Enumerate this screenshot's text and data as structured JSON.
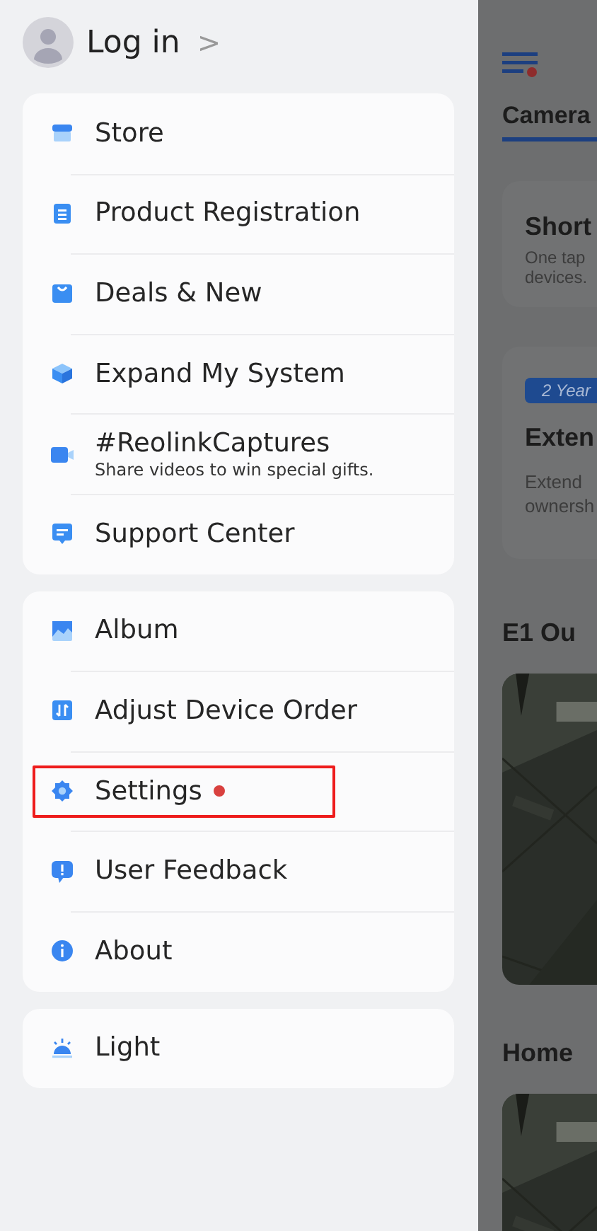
{
  "header": {
    "login_label": "Log in",
    "chevron": ">"
  },
  "menu_groups": [
    {
      "items": [
        {
          "kind": "store",
          "label": "Store",
          "badge": false,
          "highlighted": false
        },
        {
          "kind": "registration",
          "label": "Product Registration",
          "badge": false,
          "highlighted": false
        },
        {
          "kind": "deals",
          "label": "Deals & New",
          "badge": false,
          "highlighted": false
        },
        {
          "kind": "expand",
          "label": "Expand My System",
          "badge": false,
          "highlighted": false
        },
        {
          "kind": "captures",
          "label": "#ReolinkCaptures",
          "subtitle": "Share videos to win special gifts.",
          "badge": false,
          "highlighted": false
        },
        {
          "kind": "support",
          "label": "Support Center",
          "badge": false,
          "highlighted": false
        }
      ]
    },
    {
      "items": [
        {
          "kind": "album",
          "label": "Album",
          "badge": false,
          "highlighted": false
        },
        {
          "kind": "order",
          "label": "Adjust Device Order",
          "badge": false,
          "highlighted": false
        },
        {
          "kind": "settings",
          "label": "Settings",
          "badge": true,
          "highlighted": true
        },
        {
          "kind": "feedback",
          "label": "User Feedback",
          "badge": false,
          "highlighted": false
        },
        {
          "kind": "about",
          "label": "About",
          "badge": false,
          "highlighted": false
        }
      ]
    },
    {
      "items": [
        {
          "kind": "theme",
          "label": "Light",
          "badge": false,
          "highlighted": false
        }
      ]
    }
  ],
  "background_app": {
    "menu_badge": true,
    "tab": "Camera",
    "cards": [
      {
        "kind": "text",
        "title": "Short",
        "lines": [
          "One tap",
          "devices."
        ]
      },
      {
        "kind": "promo",
        "tag": "2 Year",
        "title": "Exten",
        "lines": [
          "Extend",
          "ownersh"
        ]
      },
      {
        "kind": "camera",
        "title": "E1 Ou"
      },
      {
        "kind": "camera",
        "title": "Home"
      }
    ]
  }
}
